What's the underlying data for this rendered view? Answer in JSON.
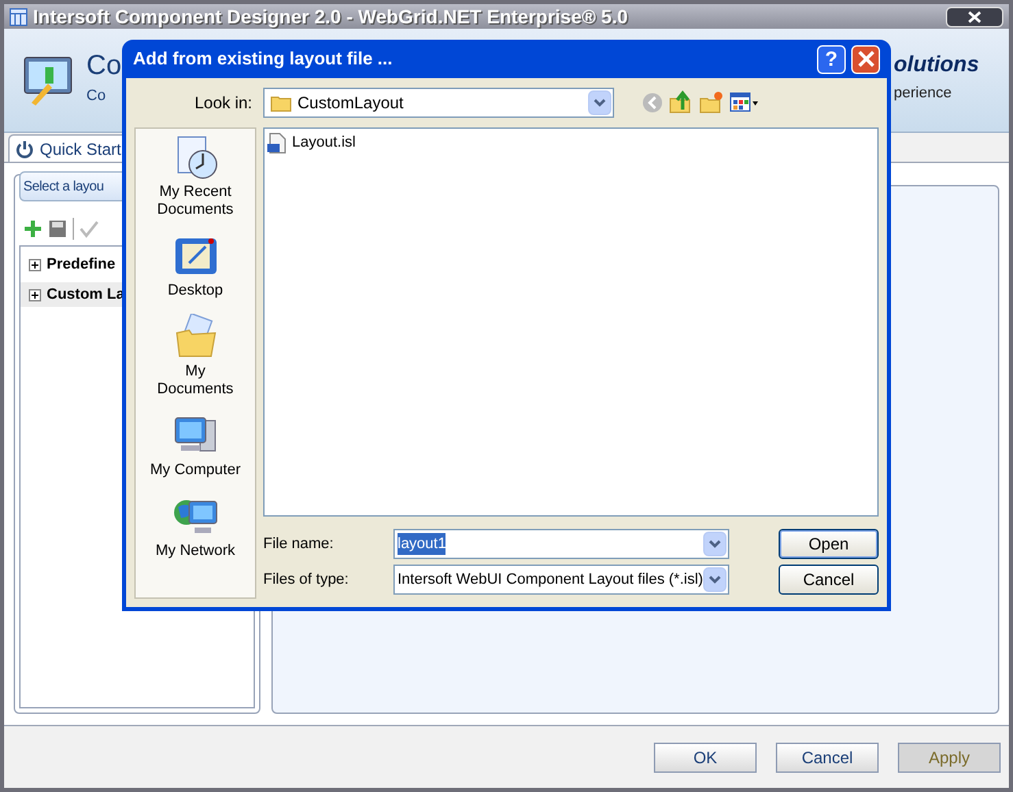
{
  "window": {
    "title": "Intersoft Component Designer 2.0 - WebGrid.NET Enterprise® 5.0"
  },
  "header": {
    "title": "Co",
    "subtitle": "Co",
    "brand": "olutions",
    "tagline": "perience"
  },
  "tabs": [
    {
      "label": "Quick Start",
      "selected": true
    }
  ],
  "layout_panel": {
    "heading": "Select a layou",
    "tree": [
      {
        "label": "Predefine",
        "expanded": false,
        "selected": false
      },
      {
        "label": "Custom La",
        "expanded": false,
        "selected": true
      }
    ]
  },
  "buttons": [
    {
      "label": "OK",
      "disabled": false
    },
    {
      "label": "Cancel",
      "disabled": false
    },
    {
      "label": "Apply",
      "disabled": true
    }
  ],
  "dialog": {
    "title": "Add from existing layout file ...",
    "look_in_label": "Look in:",
    "look_in": "CustomLayout",
    "places": [
      {
        "label": "My Recent Documents",
        "kind": "recent"
      },
      {
        "label": "Desktop",
        "kind": "desktop"
      },
      {
        "label": "My Documents",
        "kind": "documents"
      },
      {
        "label": "My Computer",
        "kind": "computer"
      },
      {
        "label": "My Network",
        "kind": "network"
      }
    ],
    "files": [
      {
        "name": "Layout.isl",
        "selected": false
      }
    ],
    "file_name_label": "File name:",
    "file_name": "layout1",
    "file_type_label": "Files of type:",
    "file_type": "Intersoft WebUI Component Layout files (*.isl)",
    "help": "?",
    "open": "Open",
    "cancel": "Cancel"
  }
}
